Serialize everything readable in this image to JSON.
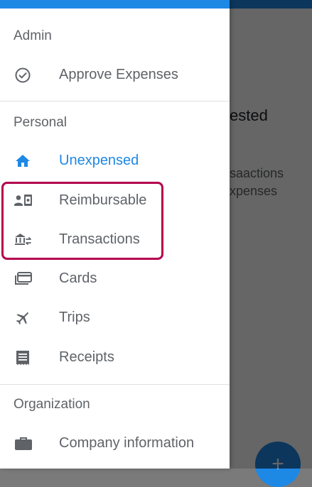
{
  "background": {
    "heading": "ested",
    "line1": "saactions",
    "line2": "xpenses",
    "fab_symbol": "+"
  },
  "drawer": {
    "sections": [
      {
        "title": "Admin",
        "items": [
          {
            "label": "Approve Expenses",
            "icon": "check-circle-icon"
          }
        ]
      },
      {
        "title": "Personal",
        "items": [
          {
            "label": "Unexpensed",
            "icon": "home-icon",
            "active": true
          },
          {
            "label": "Reimbursable",
            "icon": "reimbursable-icon"
          },
          {
            "label": "Transactions",
            "icon": "bank-transfer-icon"
          },
          {
            "label": "Cards",
            "icon": "cards-icon"
          },
          {
            "label": "Trips",
            "icon": "airplane-icon"
          },
          {
            "label": "Receipts",
            "icon": "receipt-icon"
          }
        ]
      },
      {
        "title": "Organization",
        "items": [
          {
            "label": "Company information",
            "icon": "briefcase-icon"
          }
        ]
      }
    ]
  },
  "colors": {
    "accent": "#1e88e5",
    "text_secondary": "#5f6368",
    "highlight": "#b4004e"
  }
}
